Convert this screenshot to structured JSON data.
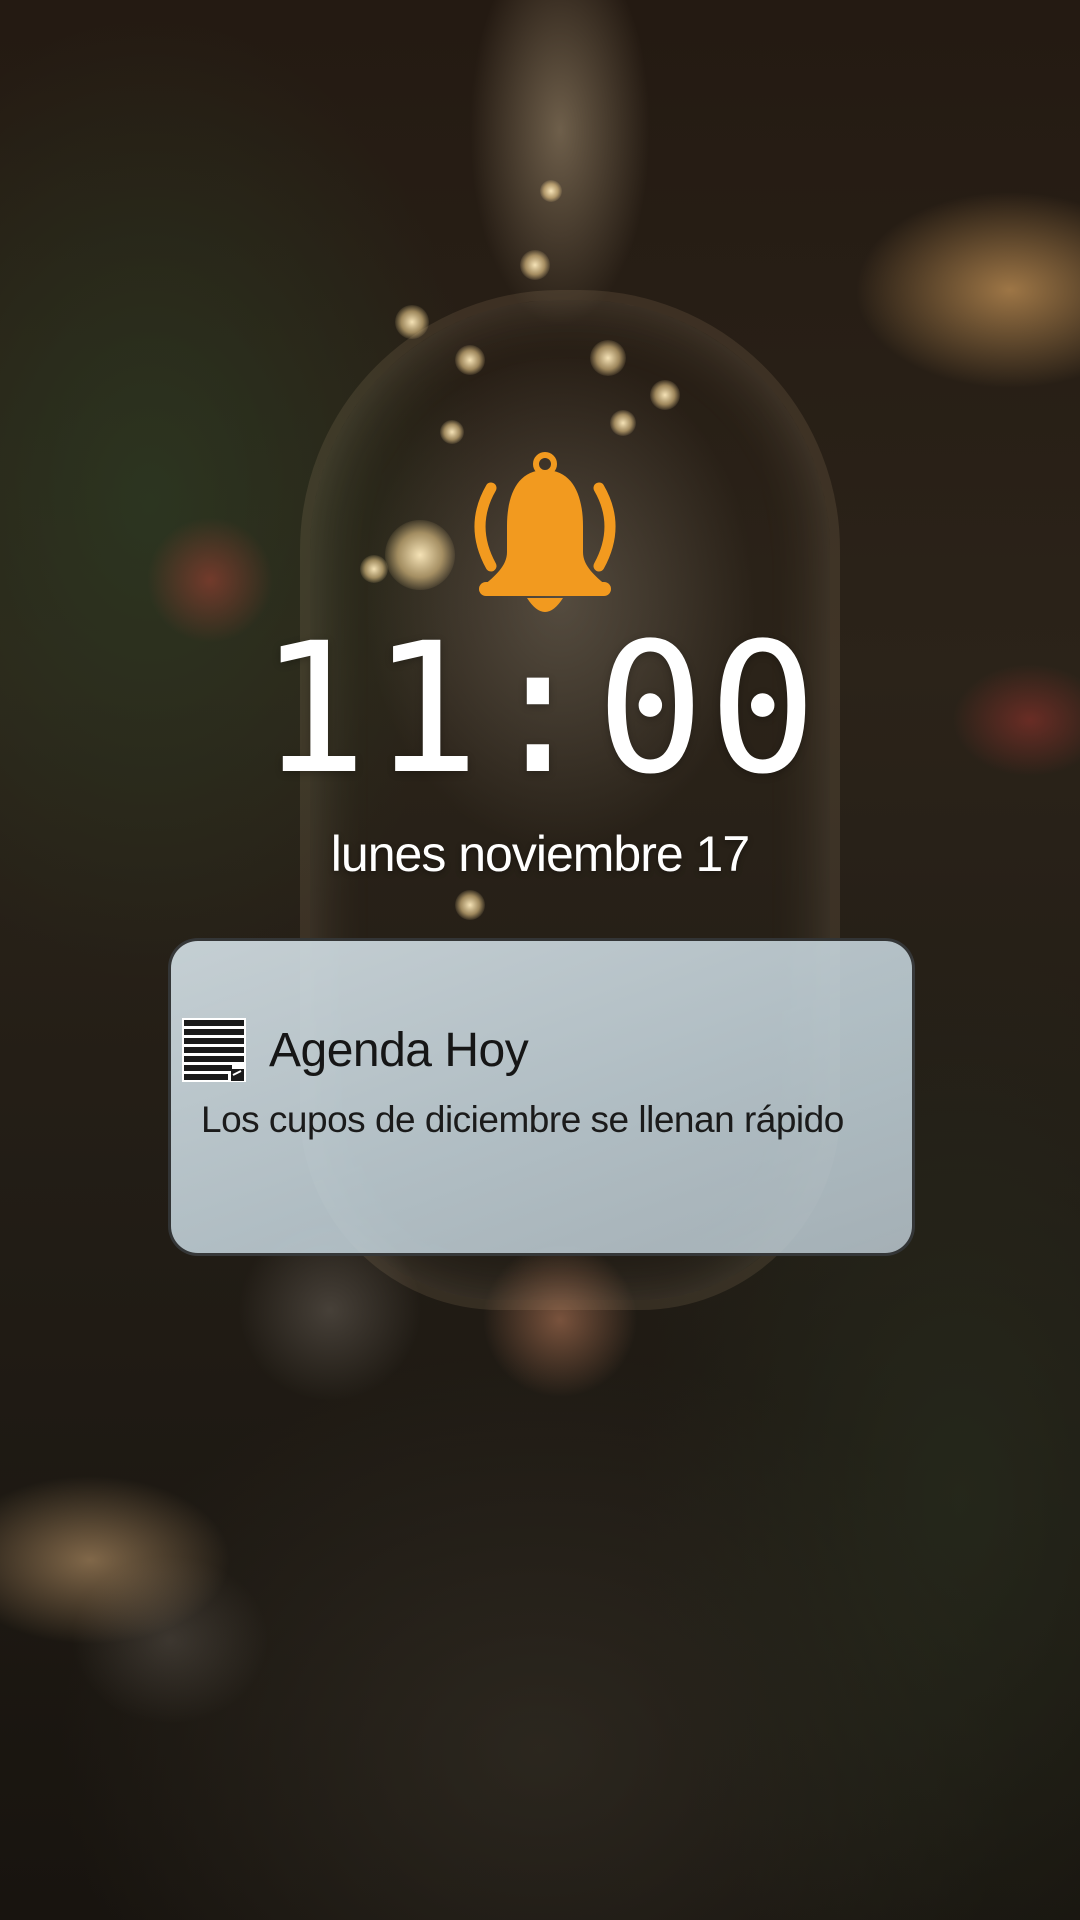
{
  "lock_screen": {
    "time": "11:00",
    "date": "lunes noviembre 17",
    "alarm_icon": "bell-ringing-icon",
    "accent_color": "#F29A1F"
  },
  "notification": {
    "app_icon": "notepad-icon",
    "app_name": "Agenda Hoy",
    "message": "Los cupos de diciembre se llenan rápido"
  }
}
